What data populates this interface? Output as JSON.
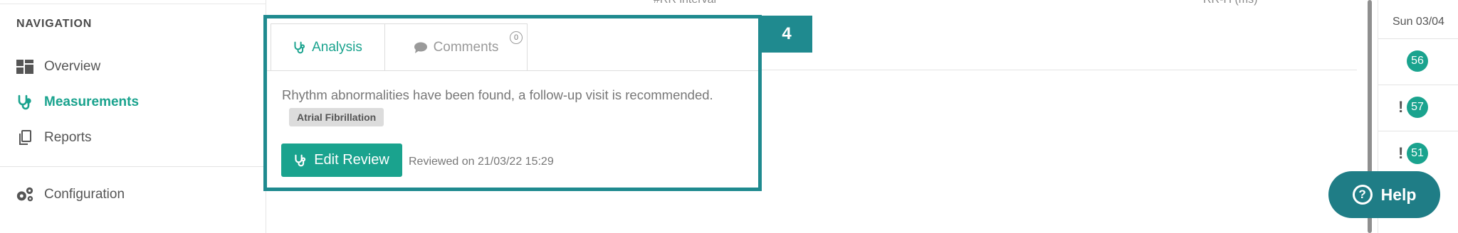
{
  "sidebar": {
    "heading": "NAVIGATION",
    "items": [
      {
        "label": "Overview",
        "icon": "dashboard-grid-icon",
        "active": false
      },
      {
        "label": "Measurements",
        "icon": "stethoscope-icon",
        "active": true
      },
      {
        "label": "Reports",
        "icon": "copy-documents-icon",
        "active": false
      }
    ],
    "config": {
      "label": "Configuration",
      "icon": "gears-icon"
    }
  },
  "table_header": {
    "col1": "#RR interval",
    "col2": "RR-H (ms)"
  },
  "review": {
    "tabs": [
      {
        "label": "Analysis",
        "icon": "stethoscope-icon"
      },
      {
        "label": "Comments",
        "icon": "comment-icon",
        "count": "0"
      }
    ],
    "text": "Rhythm abnormalities have been found, a follow-up visit is recommended.",
    "tag": "Atrial Fibrillation",
    "edit_button": "Edit Review",
    "reviewed": "Reviewed on 21/03/22 15:29"
  },
  "step_badge": "4",
  "day_column": {
    "header": "Sun 03/04",
    "rows": [
      {
        "value": "56",
        "alert": false
      },
      {
        "value": "57",
        "alert": true,
        "alert_mark": "!"
      },
      {
        "value": "51",
        "alert": true,
        "alert_mark": "!"
      }
    ]
  },
  "help": {
    "label": "Help",
    "icon_glyph": "?"
  },
  "colors": {
    "accent": "#1aa38e",
    "highlight": "#1f8a8f",
    "help": "#1f7d86"
  }
}
